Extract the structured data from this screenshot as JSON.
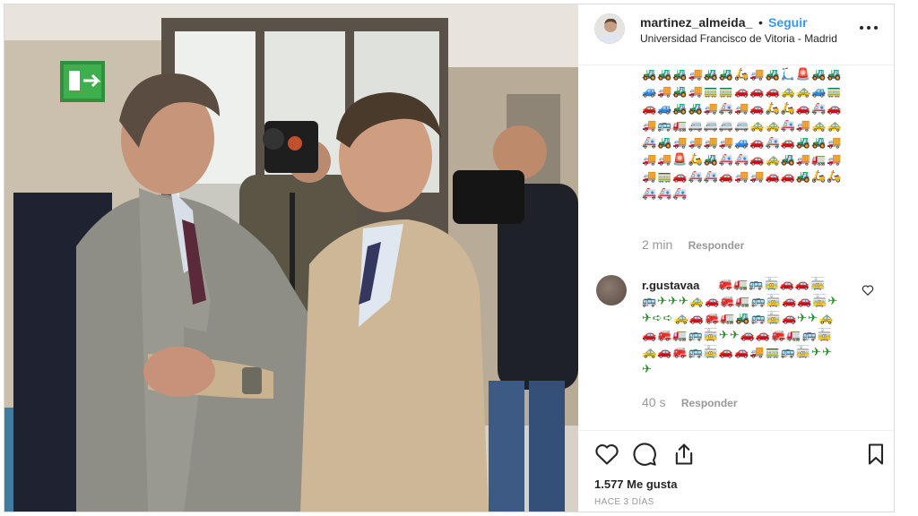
{
  "header": {
    "username": "martinez_almeida_",
    "separator": "•",
    "follow_label": "Seguir",
    "location": "Universidad Francisco de Vitoria - Madrid"
  },
  "caption": {
    "emoji_text": "🚜🚜🚜🚚🚜🚜🛵🚚🚜🛴🚨🚜🚜🚙🚚🚜🚚🚃🚃🚗🚗🚗🚕🚕🚙🚃🚗🚙🚜🚜🚚🚑🚚🚗🛵🛵🚗🚑🚗🚚🚌🚛🚐🚐🚐🚐🚕🚕🚑🚚🚕🚕🚑🚜🚚🚚🚚🚚🚙🚗🚑🚗🚜🚜🚚🚚🚚🚨🛵🚜🚑🚑🚗🚕🚜🚚🚛🚚🚚🚃🚗🚑🚑🚗🚚🚚🚗🚗🚜🛵🛵🚑🚑🚑",
    "time": "2 min",
    "reply_label": "Responder"
  },
  "comment": {
    "username": "r.gustavaa",
    "emoji_text": "🚒🚛🚌🚋🚗🚗🚋🚌✈✈✈🚕🚗🚒🚛🚌🚋🚗🚗🚋✈✈➪➪🚕🚗🚒🚛🚜🚌🚋🚗✈✈🚕🚗🚒🚛🚌🚋✈✈🚗🚗🚒🚛🚌🚋🚕🚗🚒🚌🚋🚗🚗🚚🚃🚌🚋✈✈✈",
    "time": "40 s",
    "reply_label": "Responder"
  },
  "actions": {
    "likes_label": "1.577 Me gusta",
    "date_label": "HACE 3 DÍAS"
  },
  "icons": {
    "like": "heart-icon",
    "comment": "comment-bubble-icon",
    "share": "share-icon",
    "save": "bookmark-icon",
    "more": "more-options-icon"
  },
  "colors": {
    "accent": "#3897f0",
    "text": "#262626",
    "muted": "#999999",
    "border": "#efefef"
  }
}
